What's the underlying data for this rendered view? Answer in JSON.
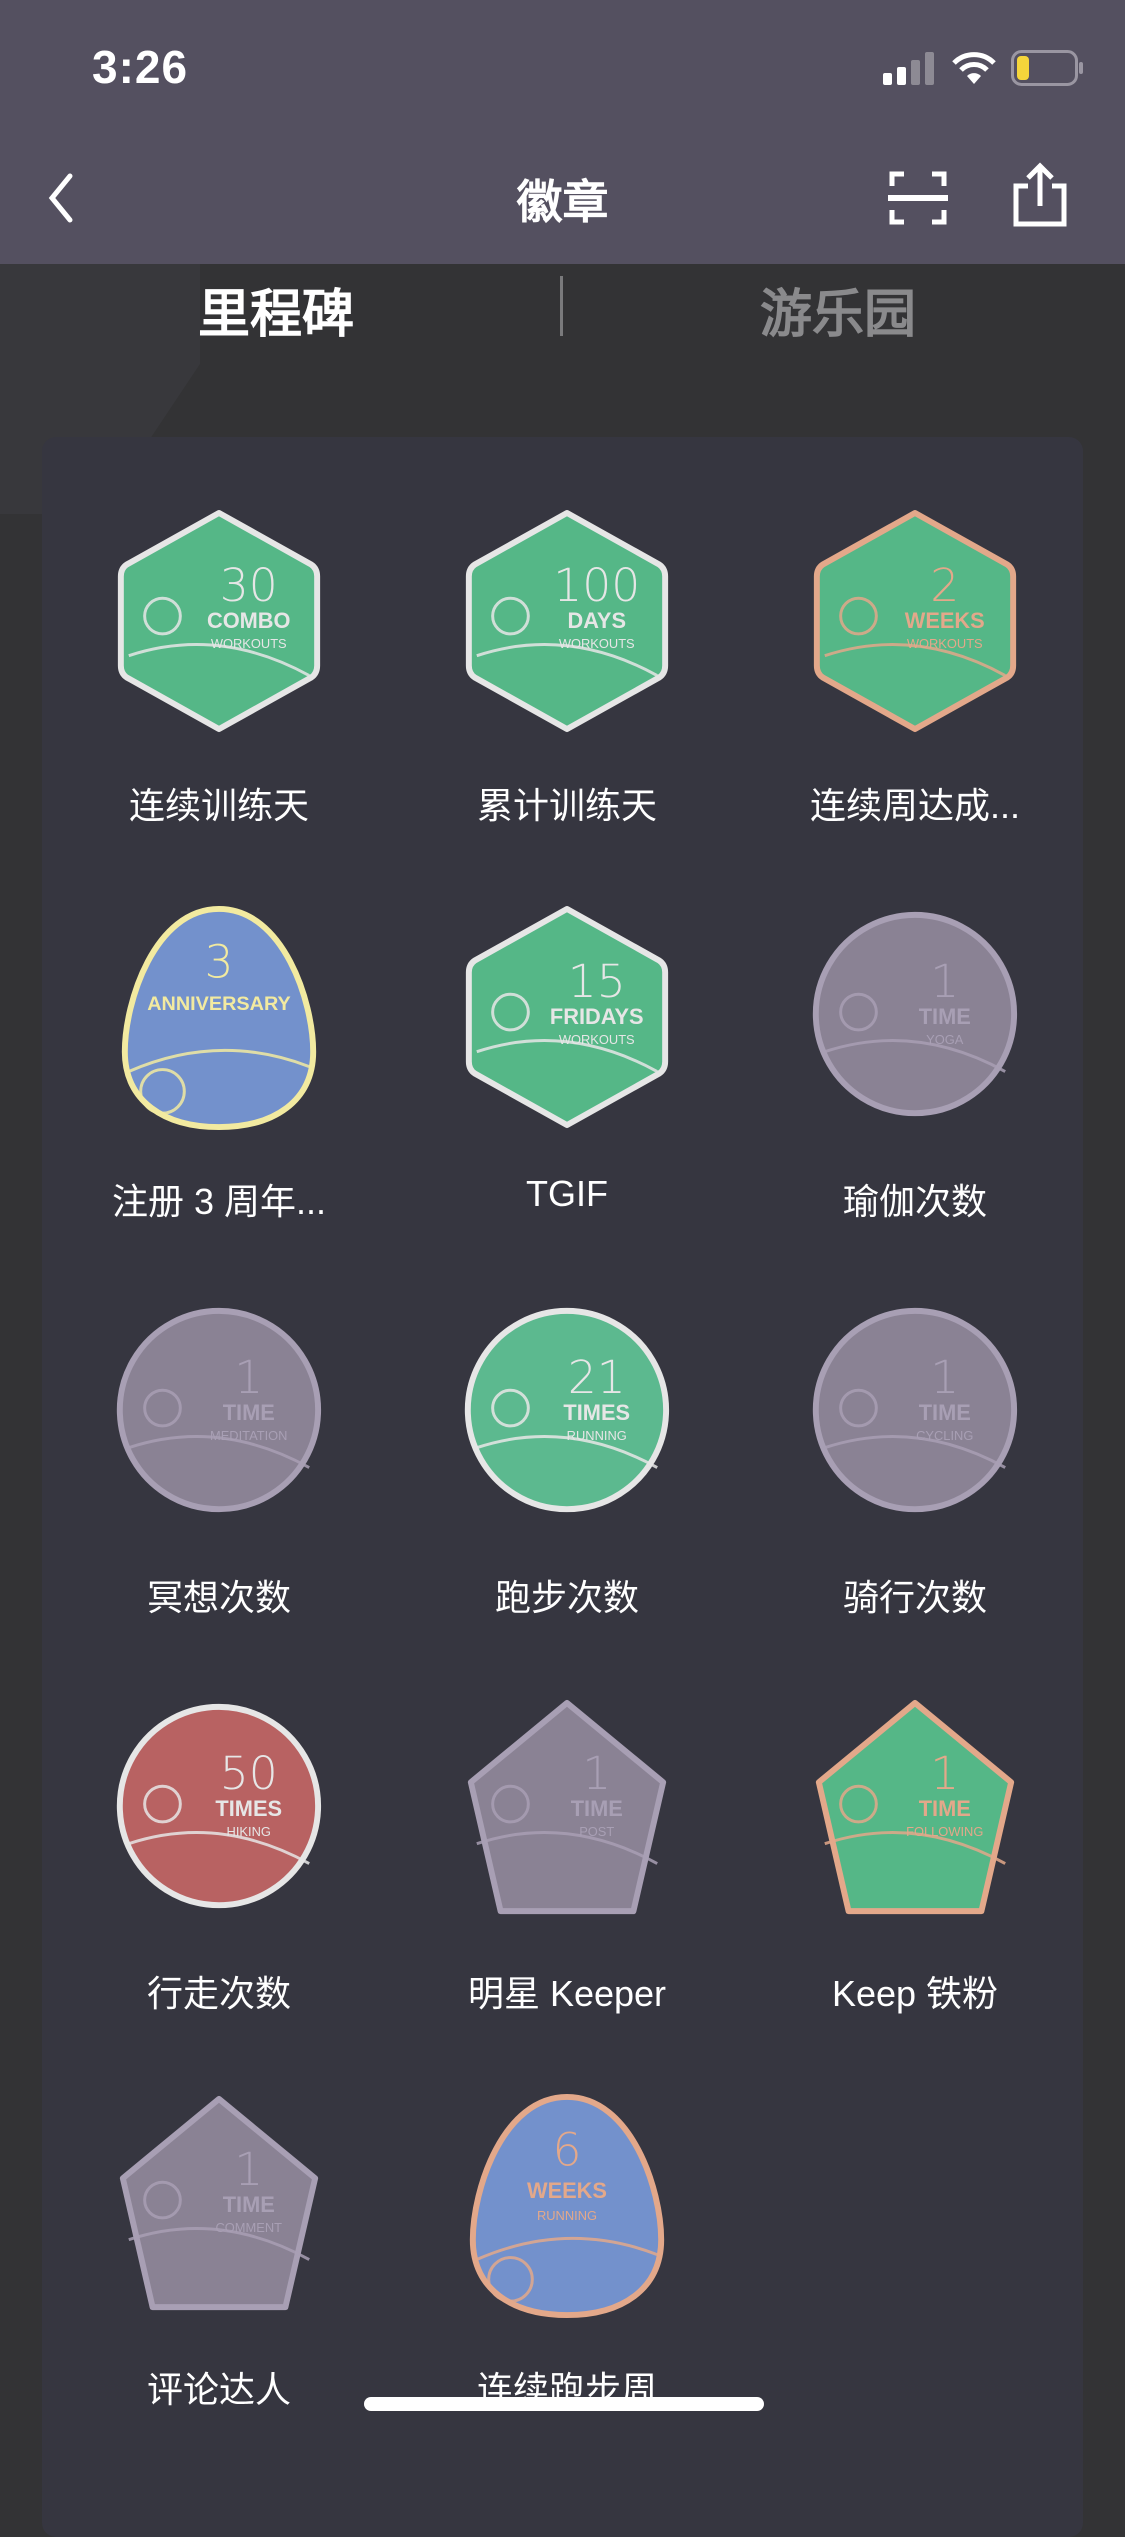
{
  "status_bar": {
    "time": "3:26",
    "battery_color": "#f5d53b"
  },
  "nav": {
    "title": "徽章",
    "back_icon": "chevron-left-icon",
    "scan_icon": "scan-icon",
    "share_icon": "share-icon"
  },
  "tabs": [
    {
      "label": "里程碑",
      "active": true
    },
    {
      "label": "游乐园",
      "active": false
    }
  ],
  "badges": [
    {
      "label": "连续训练天",
      "shape": "hex",
      "fill": "#55b787",
      "rim": "#e6e6e6",
      "num": "30",
      "l1": "COMBO",
      "l2": "WORKOUTS"
    },
    {
      "label": "累计训练天",
      "shape": "hex",
      "fill": "#55b787",
      "rim": "#e6e6e6",
      "num": "100",
      "l1": "DAYS",
      "l2": "WORKOUTS"
    },
    {
      "label": "连续周达成...",
      "shape": "hex",
      "fill": "#55b787",
      "rim": "#e3a88a",
      "num": "2",
      "l1": "WEEKS",
      "l2": "WORKOUTS"
    },
    {
      "label": "注册 3 周年...",
      "shape": "egg",
      "fill": "#7391cc",
      "rim": "#f2eaa0",
      "num": "3",
      "l1": "ANNIVERSARY",
      "l2": ""
    },
    {
      "label": "TGIF",
      "shape": "hex",
      "fill": "#55b787",
      "rim": "#e6e6e6",
      "num": "15",
      "l1": "FRIDAYS",
      "l2": "WORKOUTS"
    },
    {
      "label": "瑜伽次数",
      "shape": "circle",
      "fill": "#8a8294",
      "rim": "#a89fb4",
      "num": "1",
      "l1": "TIME",
      "l2": "YOGA"
    },
    {
      "label": "冥想次数",
      "shape": "circle",
      "fill": "#8a8294",
      "rim": "#a89fb4",
      "num": "1",
      "l1": "TIME",
      "l2": "MEDITATION"
    },
    {
      "label": "跑步次数",
      "shape": "circle",
      "fill": "#5cb98f",
      "rim": "#e6e6e6",
      "num": "21",
      "l1": "TIMES",
      "l2": "RUNNING"
    },
    {
      "label": "骑行次数",
      "shape": "circle",
      "fill": "#8a8294",
      "rim": "#a89fb4",
      "num": "1",
      "l1": "TIME",
      "l2": "CYCLING"
    },
    {
      "label": "行走次数",
      "shape": "circle",
      "fill": "#b86262",
      "rim": "#e6e6e6",
      "num": "50",
      "l1": "TIMES",
      "l2": "HIKING"
    },
    {
      "label": "明星 Keeper",
      "shape": "pent",
      "fill": "#8a8294",
      "rim": "#a89fb4",
      "num": "1",
      "l1": "TIME",
      "l2": "POST"
    },
    {
      "label": "Keep 铁粉",
      "shape": "pent",
      "fill": "#55b787",
      "rim": "#e3a88a",
      "num": "1",
      "l1": "TIME",
      "l2": "FOLLOWING"
    },
    {
      "label": "评论达人",
      "shape": "pent",
      "fill": "#8a8294",
      "rim": "#a89fb4",
      "num": "1",
      "l1": "TIME",
      "l2": "COMMENT"
    },
    {
      "label": "连续跑步周",
      "shape": "egg",
      "fill": "#7391cc",
      "rim": "#e3a88a",
      "num": "6",
      "l1": "WEEKS",
      "l2": "RUNNING"
    }
  ]
}
